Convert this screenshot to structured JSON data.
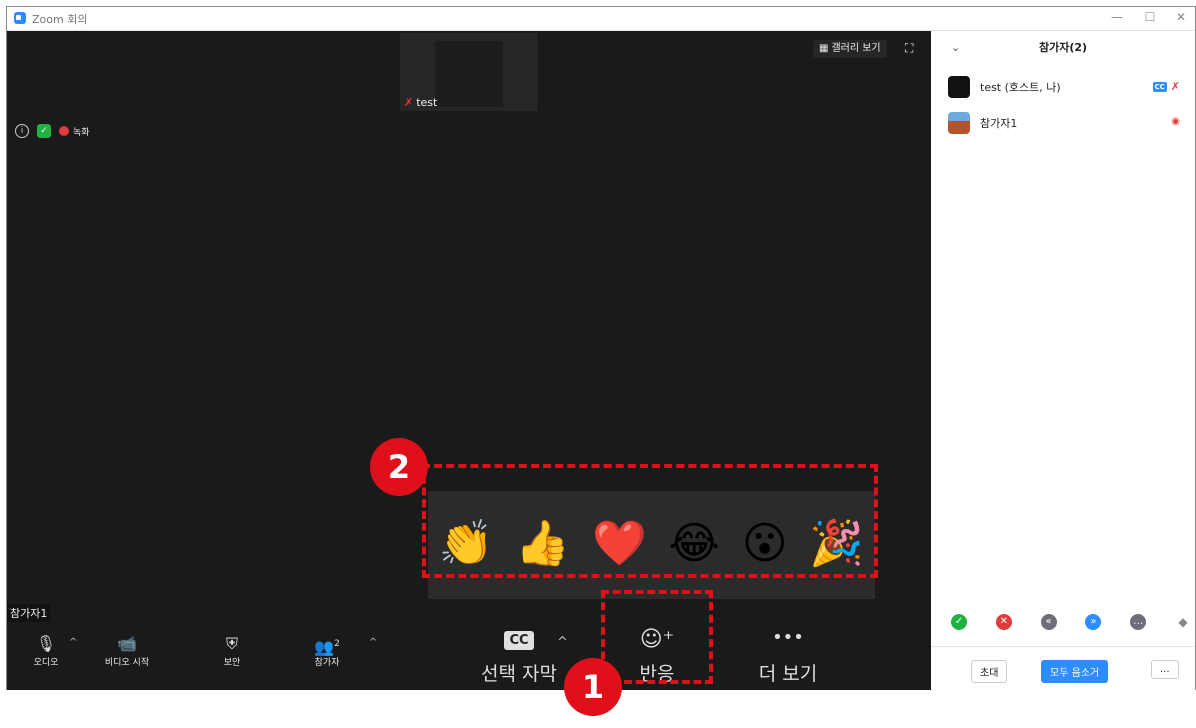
{
  "window": {
    "title": "Zoom 회의",
    "minimize_icon": "minimize-icon",
    "maximize_icon": "maximize-icon",
    "close_icon": "close-icon"
  },
  "video": {
    "thumbnail_name": "test",
    "gallery_view_label": "갤러리 보기",
    "recording_label": "녹화",
    "active_speaker_name": "참가자1"
  },
  "toolbar": {
    "audio_label": "오디오",
    "video_label": "비디오 시작",
    "security_label": "보안",
    "participants_label": "참가자",
    "participants_count": "2",
    "captions_label": "선택 자막",
    "captions_icon_text": "CC",
    "reactions_label": "반응",
    "more_label": "더 보기"
  },
  "reactions": {
    "emojis": [
      "👏",
      "👍",
      "❤️",
      "😂",
      "😮",
      "🎉"
    ]
  },
  "annotations": {
    "badge_1": "1",
    "badge_2": "2",
    "highlight_color": "#e0101b"
  },
  "participants_panel": {
    "header": "참가자(2)",
    "participants": [
      {
        "name": "test (호스트, 나)"
      },
      {
        "name": "참가자1"
      }
    ],
    "invite_label": "초대",
    "mute_all_label": "모두 음소거",
    "more_label": "..."
  },
  "colors": {
    "zoom_blue": "#2d8cff",
    "dark_bg": "#1a1a1a",
    "muted_red": "#e23b3b"
  }
}
